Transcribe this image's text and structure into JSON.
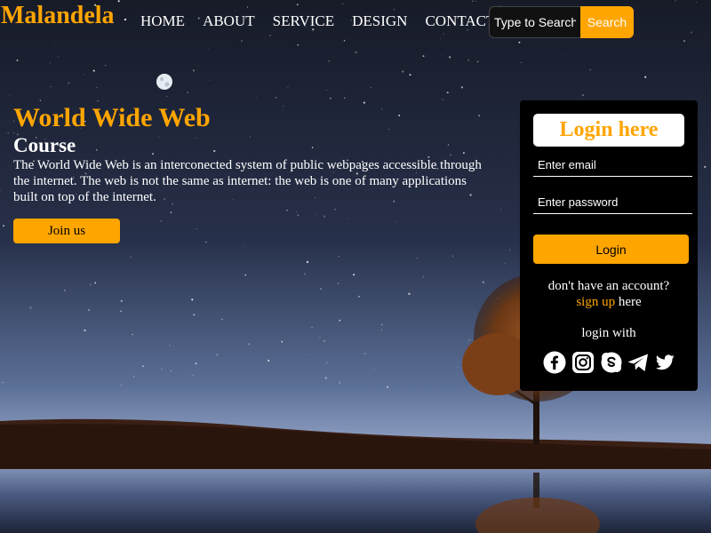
{
  "brand": {
    "name": "Malandela",
    "color": "#ffa500"
  },
  "nav": {
    "items": [
      "HOME",
      "ABOUT",
      "SERVICE",
      "DESIGN",
      "CONTACT"
    ]
  },
  "search": {
    "placeholder": "Type to Search",
    "button_label": "Search"
  },
  "hero": {
    "title": "World Wide Web",
    "subtitle": "Course",
    "description": "The World Wide Web is an interconected system of public webpages accessible through the internet. The web is not the same as internet: the web is one of many applications built on top of the internet.",
    "cta_label": "Join us"
  },
  "login": {
    "title": "Login here",
    "email_placeholder": "Enter email",
    "password_placeholder": "Enter password",
    "button_label": "Login",
    "no_account_text": "don't have an account?",
    "signup_link": "sign up",
    "signup_suffix": "here",
    "login_with": "login with",
    "social_icons": [
      "facebook-icon",
      "instagram-icon",
      "skype-icon",
      "telegram-icon",
      "twitter-icon"
    ]
  },
  "colors": {
    "accent": "#ffa500",
    "panel": "#000000",
    "text": "#ffffff"
  }
}
